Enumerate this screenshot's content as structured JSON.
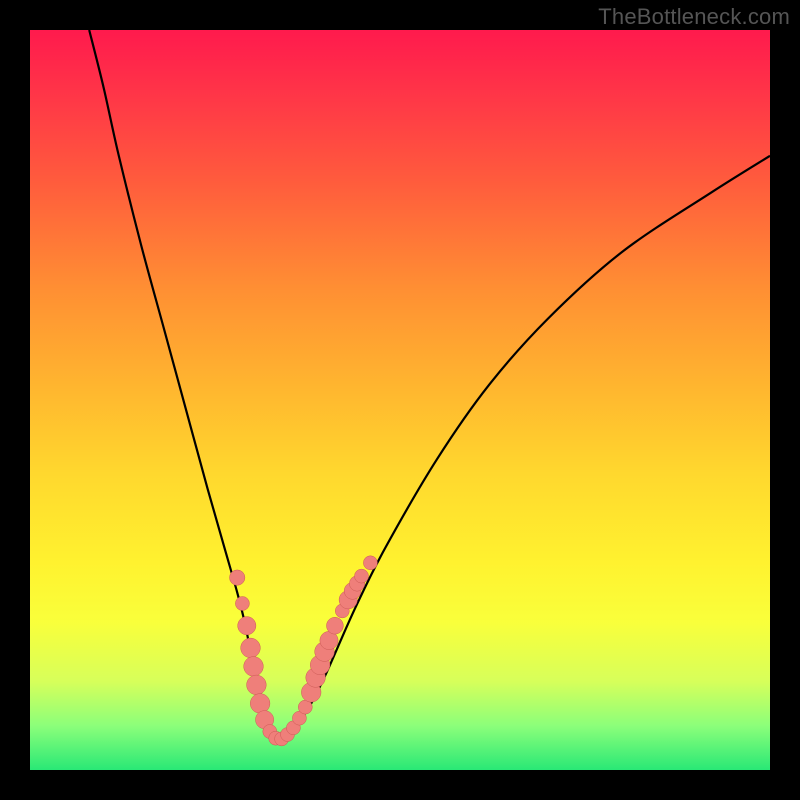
{
  "watermark": "TheBottleneck.com",
  "colors": {
    "frame": "#000000",
    "gradient_top": "#ff1a4d",
    "gradient_bottom": "#29e876",
    "curve_stroke": "#000000",
    "marker_fill": "#ef7f7a",
    "marker_stroke": "#cc5a55"
  },
  "chart_data": {
    "type": "line",
    "title": "",
    "xlabel": "",
    "ylabel": "",
    "xlim": [
      0,
      100
    ],
    "ylim": [
      0,
      100
    ],
    "grid": false,
    "legend": false,
    "annotations": [
      "TheBottleneck.com"
    ],
    "series": [
      {
        "name": "bottleneck-curve",
        "x": [
          8,
          10,
          12,
          15,
          18,
          21,
          24,
          26,
          28,
          29,
          30,
          31,
          32,
          33,
          34,
          35,
          36,
          38,
          40,
          44,
          48,
          55,
          62,
          70,
          80,
          92,
          100
        ],
        "values": [
          100,
          92,
          83,
          71,
          60,
          49,
          38,
          31,
          24,
          20,
          15,
          10,
          6,
          4,
          4,
          5,
          6,
          9,
          13,
          22,
          30,
          42,
          52,
          61,
          70,
          78,
          83
        ]
      }
    ],
    "markers": [
      {
        "x": 28.0,
        "y": 26.0,
        "r": 1.1
      },
      {
        "x": 28.7,
        "y": 22.5,
        "r": 1.0
      },
      {
        "x": 29.3,
        "y": 19.5,
        "r": 1.3
      },
      {
        "x": 29.8,
        "y": 16.5,
        "r": 1.4
      },
      {
        "x": 30.2,
        "y": 14.0,
        "r": 1.4
      },
      {
        "x": 30.6,
        "y": 11.5,
        "r": 1.4
      },
      {
        "x": 31.1,
        "y": 9.0,
        "r": 1.4
      },
      {
        "x": 31.7,
        "y": 6.8,
        "r": 1.3
      },
      {
        "x": 32.4,
        "y": 5.2,
        "r": 1.0
      },
      {
        "x": 33.2,
        "y": 4.3,
        "r": 1.0
      },
      {
        "x": 34.0,
        "y": 4.2,
        "r": 1.0
      },
      {
        "x": 34.8,
        "y": 4.8,
        "r": 1.0
      },
      {
        "x": 35.6,
        "y": 5.7,
        "r": 1.0
      },
      {
        "x": 36.4,
        "y": 7.0,
        "r": 1.0
      },
      {
        "x": 37.2,
        "y": 8.5,
        "r": 1.0
      },
      {
        "x": 38.0,
        "y": 10.5,
        "r": 1.4
      },
      {
        "x": 38.6,
        "y": 12.5,
        "r": 1.4
      },
      {
        "x": 39.2,
        "y": 14.2,
        "r": 1.4
      },
      {
        "x": 39.8,
        "y": 16.0,
        "r": 1.4
      },
      {
        "x": 40.4,
        "y": 17.5,
        "r": 1.3
      },
      {
        "x": 41.2,
        "y": 19.5,
        "r": 1.2
      },
      {
        "x": 42.2,
        "y": 21.5,
        "r": 1.0
      },
      {
        "x": 43.0,
        "y": 23.0,
        "r": 1.3
      },
      {
        "x": 43.6,
        "y": 24.2,
        "r": 1.2
      },
      {
        "x": 44.2,
        "y": 25.2,
        "r": 1.1
      },
      {
        "x": 44.8,
        "y": 26.2,
        "r": 1.0
      },
      {
        "x": 46.0,
        "y": 28.0,
        "r": 1.0
      }
    ]
  }
}
